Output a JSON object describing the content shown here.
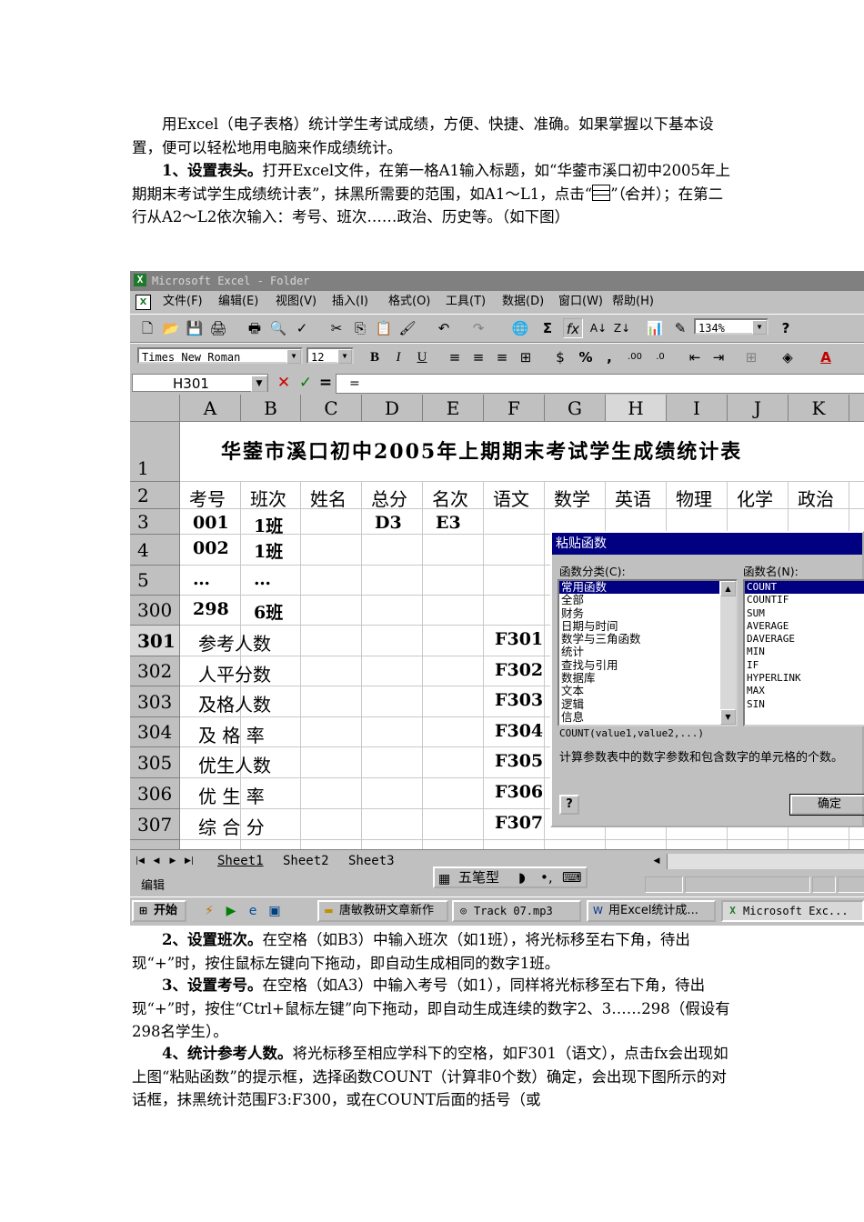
{
  "document": {
    "para1": "用Excel（电子表格）统计学生考试成绩，方便、快捷、准确。如果掌握以下基本设置，便可以轻松地用电脑来作成绩统计。",
    "para2_lead": "1、设置表头。",
    "para2_a": "打开Excel文件，在第一格A1输入标题，如“华蓥市溪口初中2005年上期期末考试学生成绩统计表”，抹黑所需要的范围，如A1～L1，点击“",
    "para2_b": "”（合并）；在第二行从A2～L2依次输入：考号、班次……政治、历史等。（如下图）",
    "para3_lead": "2、设置班次。",
    "para3": "在空格（如B3）中输入班次（如1班），将光标移至右下角，待出现“+”时，按住鼠标左键向下拖动，即自动生成相同的数字1班。",
    "para4_lead": "3、设置考号。",
    "para4": "在空格（如A3）中输入考号（如1），同样将光标移至右下角，待出现“+”时，按住“Ctrl+鼠标左键”向下拖动，即自动生成连续的数字2、3……298（假设有298名学生）。",
    "para5_lead": "4、统计参考人数。",
    "para5": "将光标移至相应学科下的空格，如F301（语文），点击fx会出现如上图“粘贴函数”的提示框，选择函数COUNT（计算非0个数）确定，会出现下图所示的对话框，抹黑统计范围F3:F300，或在COUNT后面的括号（或"
  },
  "excel": {
    "window_title": "Microsoft Excel - Folder",
    "menu": [
      "文件(F)",
      "编辑(E)",
      "视图(V)",
      "插入(I)",
      "格式(O)",
      "工具(T)",
      "数据(D)",
      "窗口(W)",
      "帮助(H)"
    ],
    "zoom": "134%",
    "font_name": "Times New Roman",
    "font_size": "12",
    "name_box": "H301",
    "formula_equals": "=",
    "columns": [
      "A",
      "B",
      "C",
      "D",
      "E",
      "F",
      "G",
      "H",
      "I",
      "J",
      "K"
    ],
    "row_numbers": [
      "1",
      "2",
      "3",
      "4",
      "5",
      "300",
      "301",
      "302",
      "303",
      "304",
      "305",
      "306",
      "307"
    ],
    "sheet_title": "华蓥市溪口初中2005年上期期末考试学生成绩统计表",
    "headers": [
      "考号",
      "班次",
      "姓名",
      "总分",
      "名次",
      "语文",
      "数学",
      "英语",
      "物理",
      "化学",
      "政治"
    ],
    "row3": {
      "a": "001",
      "b": "1班",
      "d": "D3",
      "e": "E3"
    },
    "row4": {
      "a": "002",
      "b": "1班"
    },
    "row5": {
      "a": "…",
      "b": "…"
    },
    "row300": {
      "a": "298",
      "b": "6班"
    },
    "stat_labels": [
      "参考人数",
      "人平分数",
      "及格人数",
      "及 格 率",
      "优生人数",
      "优 生 率",
      "综 合 分"
    ],
    "stat_refs": [
      "F301",
      "F302",
      "F303",
      "F304",
      "F305",
      "F306",
      "F307"
    ],
    "sheets": [
      "Sheet1",
      "Sheet2",
      "Sheet3"
    ],
    "status_mode": "编辑",
    "ime": "五笔型"
  },
  "dialog": {
    "title": "粘贴函数",
    "category_label": "函数分类(C):",
    "function_label": "函数名(N):",
    "categories": [
      "常用函数",
      "全部",
      "财务",
      "日期与时间",
      "数学与三角函数",
      "统计",
      "查找与引用",
      "数据库",
      "文本",
      "逻辑",
      "信息"
    ],
    "functions": [
      "COUNT",
      "COUNTIF",
      "SUM",
      "AVERAGE",
      "DAVERAGE",
      "MIN",
      "IF",
      "HYPERLINK",
      "MAX",
      "SIN"
    ],
    "syntax": "COUNT(value1,value2,...)",
    "description": "计算参数表中的数字参数和包含数字的单元格的个数。",
    "help_label": "?",
    "ok_label": "确定"
  },
  "taskbar": {
    "start": "开始",
    "tasks": [
      "唐敏教研文章新作",
      "Track 07.mp3",
      "用Excel统计成...",
      "Microsoft Exc..."
    ]
  }
}
